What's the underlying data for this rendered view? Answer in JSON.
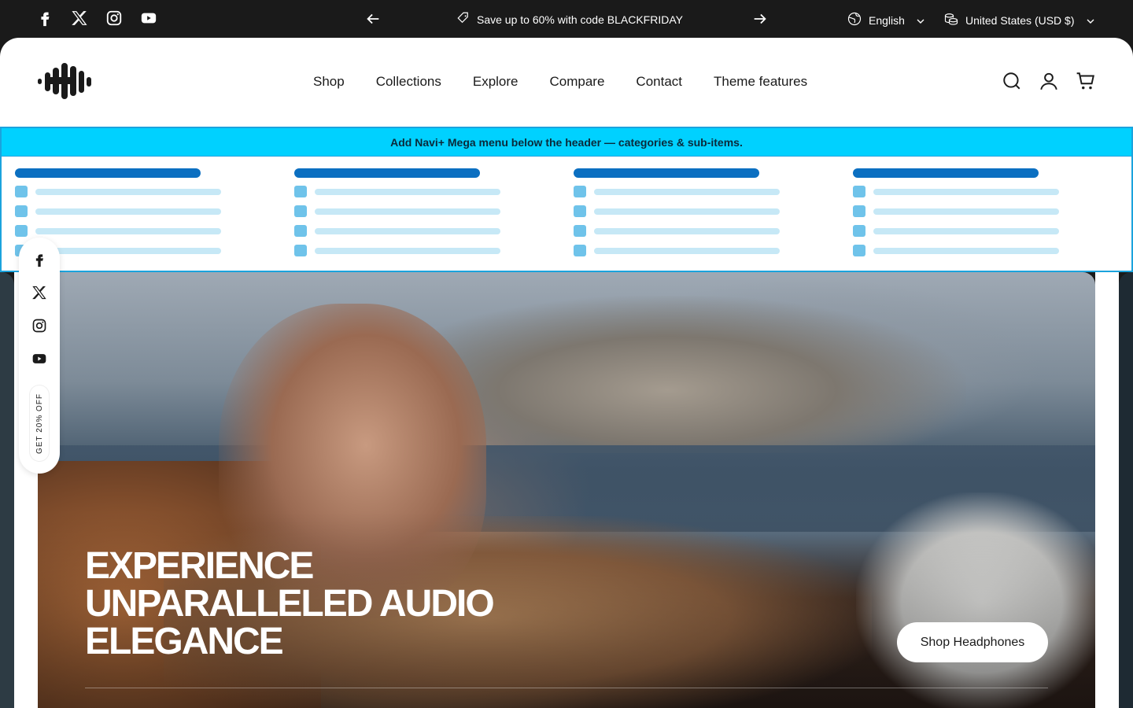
{
  "topbar": {
    "announcement": "Save up to 60% with code BLACKFRIDAY",
    "language": "English",
    "currency": "United States (USD $)",
    "socials": [
      "facebook-icon",
      "x-icon",
      "instagram-icon",
      "youtube-icon"
    ]
  },
  "header": {
    "nav": [
      "Shop",
      "Collections",
      "Explore",
      "Compare",
      "Contact",
      "Theme features"
    ]
  },
  "mega": {
    "banner": "Add Navi+ Mega menu below the header — categories & sub-items."
  },
  "hero": {
    "title": "EXPERIENCE UNPARALLELED AUDIO ELEGANCE",
    "cta": "Shop Headphones"
  },
  "float": {
    "promo": "GET 20% OFF"
  },
  "colors": {
    "accent": "#00d1ff",
    "mega_heading": "#0b6fc1",
    "dark": "#1a1a1a"
  }
}
